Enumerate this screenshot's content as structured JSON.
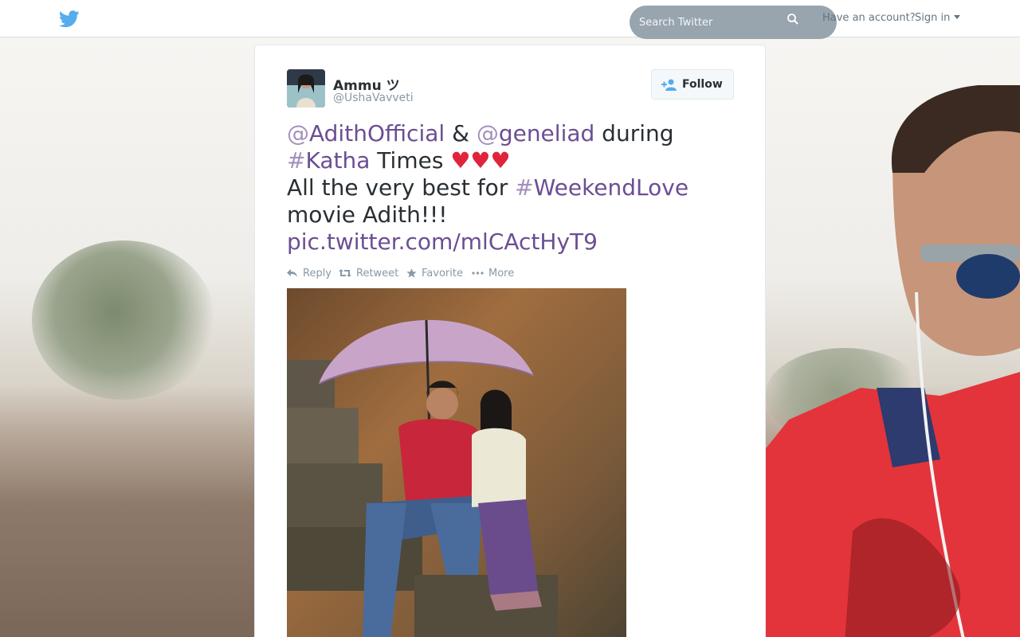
{
  "topbar": {
    "search_placeholder": "Search Twitter",
    "have_account": "Have an account?",
    "sign_in": "Sign in"
  },
  "tweet": {
    "fullname": "Ammu ツ",
    "username": "@UshaVavveti",
    "follow_label": "Follow",
    "text": {
      "at1": "@",
      "mention1": "AdithOfficial",
      "amp": " & ",
      "at2": "@",
      "mention2": "geneliad",
      "during": " during",
      "hash1": "#",
      "tag1": "Katha",
      "times": " Times ",
      "hearts": "♥♥♥",
      "line3": "All the very best for ",
      "hash2": "#",
      "tag2": "WeekendLove",
      "line4": "movie Adith!!!",
      "link": "pic.twitter.com/mlCActHyT9"
    },
    "actions": {
      "reply": "Reply",
      "retweet": "Retweet",
      "favorite": "Favorite",
      "more": "More"
    }
  },
  "colors": {
    "twitter_blue": "#55acee",
    "link_purple": "#6b4e93",
    "heart_red": "#e0243c"
  }
}
